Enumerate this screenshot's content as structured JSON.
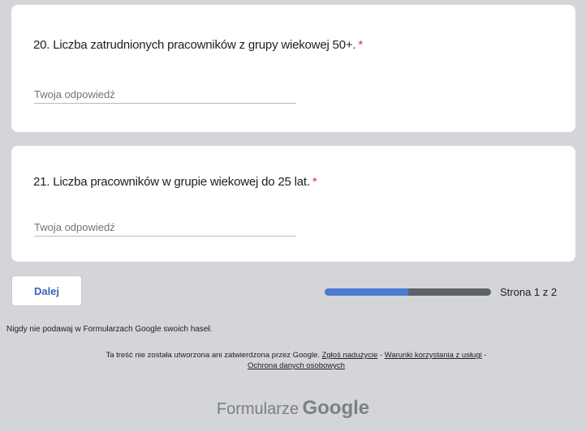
{
  "questions": [
    {
      "title": "20. Liczba zatrudnionych pracowników z grupy wiekowej 50+.",
      "required_mark": "*",
      "placeholder": "Twoja odpowiedź"
    },
    {
      "title": "21. Liczba pracowników w grupie wiekowej do 25 lat.",
      "required_mark": "*",
      "placeholder": "Twoja odpowiedź"
    }
  ],
  "navigation": {
    "next_label": "Dalej",
    "progress_fraction": 0.5,
    "page_label": "Strona 1 z 2"
  },
  "footer": {
    "password_warning": "Nigdy nie podawaj w Formularzach Google swoich haseł.",
    "disclaimer_text": "Ta treść nie została utworzona ani zatwierdzona przez Google.",
    "links": {
      "report_abuse": "Zgłoś nadużycie",
      "terms": "Warunki korzystania z usługi",
      "privacy": "Ochrona danych osobowych"
    },
    "separator": " - ",
    "brand_prefix": "Formularze",
    "brand_google": "Google"
  },
  "colors": {
    "background": "#d3d5d9",
    "card": "#ffffff",
    "required": "#d93025",
    "accent": "#4a7bd0",
    "button_text": "#3b63b9"
  }
}
